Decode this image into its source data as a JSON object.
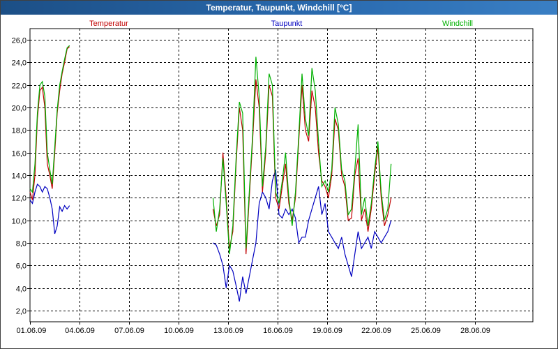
{
  "window": {
    "title": "Temperatur, Taupunkt, Windchill [°C]"
  },
  "colors": {
    "temperatur": "#c00000",
    "taupunkt": "#0000c0",
    "windchill": "#00b000",
    "grid": "#000000"
  },
  "chart_data": {
    "type": "line",
    "title": "Temperatur, Taupunkt, Windchill [°C]",
    "xlabel": "",
    "ylabel": "",
    "xlim": [
      0,
      30.5
    ],
    "ylim": [
      1,
      27
    ],
    "y_ticks": [
      "2,0",
      "4,0",
      "6,0",
      "8,0",
      "10,0",
      "12,0",
      "14,0",
      "16,0",
      "18,0",
      "20,0",
      "22,0",
      "24,0",
      "26,0"
    ],
    "y_tick_values": [
      2,
      4,
      6,
      8,
      10,
      12,
      14,
      16,
      18,
      20,
      22,
      24,
      26
    ],
    "x_ticks": [
      "01.06.09",
      "04.06.09",
      "07.06.09",
      "10.06.09",
      "13.06.09",
      "16.06.09",
      "19.06.09",
      "22.06.09",
      "25.06.09",
      "28.06.09"
    ],
    "x_tick_values": [
      0,
      3,
      6,
      9,
      12,
      15,
      18,
      21,
      24,
      27
    ],
    "grid": true,
    "legend": "top",
    "series": [
      {
        "name": "Temperatur",
        "segments": [
          {
            "x": [
              0,
              0.15,
              0.3,
              0.45,
              0.6,
              0.75,
              0.9,
              1.05,
              1.2,
              1.35,
              1.5,
              1.65,
              1.8,
              1.95,
              2.1,
              2.25,
              2.4
            ],
            "y": [
              12.5,
              11.8,
              14,
              19,
              21.5,
              21.8,
              20,
              15,
              14,
              12.8,
              16,
              19.5,
              21.5,
              23,
              24,
              25.2,
              25.4
            ]
          },
          {
            "x": [
              11.1,
              11.3,
              11.5,
              11.7,
              11.9,
              12.1,
              12.3,
              12.5,
              12.7,
              12.9,
              13.1,
              13.3,
              13.5,
              13.7,
              13.9,
              14.1,
              14.3,
              14.5,
              14.7,
              14.9,
              15.1,
              15.3,
              15.5,
              15.7,
              15.9,
              16.1,
              16.3,
              16.5,
              16.7,
              16.9,
              17.1,
              17.3,
              17.5,
              17.7,
              17.9,
              18.1,
              18.3,
              18.5,
              18.7,
              18.9,
              19.1,
              19.3,
              19.5,
              19.7,
              19.9,
              20.1,
              20.3,
              20.5,
              20.7,
              20.9,
              21.1,
              21.3,
              21.5,
              21.7,
              21.9
            ],
            "y": [
              11,
              9.5,
              10.5,
              16,
              12,
              7.5,
              9,
              15,
              20,
              18,
              7,
              12,
              17,
              22.5,
              20,
              12.5,
              16,
              22,
              21,
              12,
              11,
              13,
              15,
              11.5,
              10,
              12,
              17,
              22,
              18,
              17,
              21.5,
              20,
              16,
              13.5,
              13,
              12,
              14,
              19,
              18,
              14,
              13,
              10,
              10.2,
              14,
              15.5,
              10,
              11,
              9,
              11,
              14,
              16.5,
              12,
              9.5,
              10.5,
              12
            ]
          }
        ]
      },
      {
        "name": "Taupunkt",
        "segments": [
          {
            "x": [
              0,
              0.15,
              0.3,
              0.45,
              0.6,
              0.75,
              0.9,
              1.05,
              1.2,
              1.35,
              1.5,
              1.65,
              1.8,
              1.95,
              2.1,
              2.25,
              2.4
            ],
            "y": [
              11.8,
              11.5,
              12.5,
              13.2,
              13,
              12.5,
              13,
              12.8,
              12,
              11,
              8.8,
              9.5,
              11.2,
              10.8,
              11.3,
              11,
              11.3
            ]
          },
          {
            "x": [
              11.1,
              11.3,
              11.5,
              11.7,
              11.9,
              12.1,
              12.3,
              12.5,
              12.7,
              12.9,
              13.1,
              13.3,
              13.5,
              13.7,
              13.9,
              14.1,
              14.3,
              14.5,
              14.7,
              14.9,
              15.1,
              15.3,
              15.5,
              15.7,
              15.9,
              16.1,
              16.3,
              16.5,
              16.7,
              16.9,
              17.1,
              17.3,
              17.5,
              17.7,
              17.9,
              18.1,
              18.3,
              18.5,
              18.7,
              18.9,
              19.1,
              19.3,
              19.5,
              19.7,
              19.9,
              20.1,
              20.3,
              20.5,
              20.7,
              20.9,
              21.1,
              21.3,
              21.5,
              21.7,
              21.9
            ],
            "y": [
              8,
              7.8,
              7,
              6,
              4,
              6,
              5.5,
              4.2,
              2.8,
              5,
              3.5,
              5,
              6.5,
              8,
              11.5,
              12.5,
              12,
              11,
              13.5,
              14.5,
              10.5,
              10.2,
              11,
              10.5,
              11,
              10.2,
              8,
              8.5,
              8.5,
              10,
              11,
              12,
              13,
              10.5,
              11.5,
              9,
              8.5,
              8,
              7.5,
              8.5,
              7,
              6,
              5,
              7,
              9,
              7.5,
              8,
              8.5,
              7.5,
              9,
              8.5,
              8,
              8.5,
              9,
              10
            ]
          }
        ]
      },
      {
        "name": "Windchill",
        "segments": [
          {
            "x": [
              0,
              0.15,
              0.3,
              0.45,
              0.6,
              0.75,
              0.9,
              1.05,
              1.2,
              1.35,
              1.5,
              1.65,
              1.8,
              1.95,
              2.1,
              2.25,
              2.4
            ],
            "y": [
              12.8,
              12.5,
              15,
              19.5,
              22,
              22.3,
              21,
              16,
              14.5,
              13.2,
              16.5,
              19.8,
              22,
              23.2,
              24.3,
              25.3,
              25.5
            ]
          },
          {
            "x": [
              11.1,
              11.3,
              11.5,
              11.7,
              11.9,
              12.1,
              12.3,
              12.5,
              12.7,
              12.9,
              13.1,
              13.3,
              13.5,
              13.7,
              13.9,
              14.1,
              14.3,
              14.5,
              14.7,
              14.9,
              15.1,
              15.3,
              15.5,
              15.7,
              15.9,
              16.1,
              16.3,
              16.5,
              16.7,
              16.9,
              17.1,
              17.3,
              17.5,
              17.7,
              17.9,
              18.1,
              18.3,
              18.5,
              18.7,
              18.9,
              19.1,
              19.3,
              19.5,
              19.7,
              19.9,
              20.1,
              20.3,
              20.5,
              20.7,
              20.9,
              21.1,
              21.3,
              21.5,
              21.7,
              21.9
            ],
            "y": [
              12,
              9,
              11,
              15.5,
              11.5,
              7,
              9.5,
              15.5,
              20.5,
              19.5,
              7.5,
              12.5,
              17.5,
              24.5,
              21,
              13,
              16.5,
              23,
              22,
              12.5,
              11.5,
              13.5,
              16,
              12,
              9.5,
              12.5,
              17.5,
              23,
              19,
              17.5,
              23.5,
              21.5,
              17,
              13,
              13.5,
              12.5,
              14.5,
              20,
              18.5,
              14.5,
              13.5,
              10.5,
              11,
              14.5,
              18.5,
              10.5,
              12,
              9.5,
              11.5,
              14.5,
              17,
              12.5,
              10,
              11,
              15
            ]
          }
        ]
      }
    ]
  }
}
